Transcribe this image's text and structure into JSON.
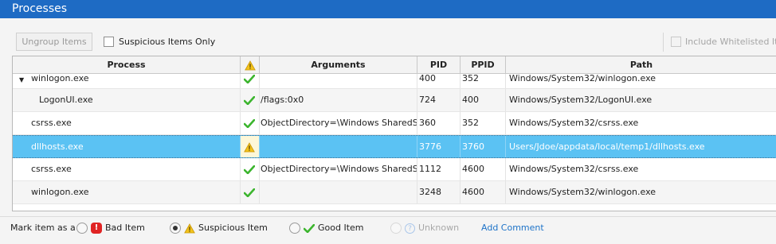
{
  "window": {
    "title": "Processes"
  },
  "toolbar": {
    "ungroup_label": "Ungroup Items",
    "suspicious_only_label": "Suspicious Items Only",
    "include_whitelisted_label": "Include Whitelisted Ite"
  },
  "table": {
    "headers": {
      "process": "Process",
      "arguments": "Arguments",
      "pid": "PID",
      "ppid": "PPID",
      "path": "Path"
    },
    "rows": [
      {
        "process": "winlogon.exe",
        "status": "good",
        "arguments": "",
        "pid": "400",
        "ppid": "352",
        "path": "Windows/System32/winlogon.exe",
        "expanded": true
      },
      {
        "process": "LogonUI.exe",
        "status": "good",
        "arguments": "/flags:0x0",
        "pid": "724",
        "ppid": "400",
        "path": "Windows/System32/LogonUI.exe"
      },
      {
        "process": "csrss.exe",
        "status": "good",
        "arguments": "ObjectDirectory=\\Windows SharedS...",
        "pid": "360",
        "ppid": "352",
        "path": "Windows/System32/csrss.exe"
      },
      {
        "process": "dllhosts.exe",
        "status": "suspicious",
        "arguments": "",
        "pid": "3776",
        "ppid": "3760",
        "path": "Users/Jdoe/appdata/local/temp1/dllhosts.exe",
        "selected": true
      },
      {
        "process": "csrss.exe",
        "status": "good",
        "arguments": "ObjectDirectory=\\Windows SharedS...",
        "pid": "1112",
        "ppid": "4600",
        "path": "Windows/System32/csrss.exe"
      },
      {
        "process": "winlogon.exe",
        "status": "good",
        "arguments": "",
        "pid": "3248",
        "ppid": "4600",
        "path": "Windows/System32/winlogon.exe"
      }
    ]
  },
  "statusbar": {
    "mark_as_label": "Mark item as a",
    "bad_label": "Bad Item",
    "bad_badge": "!",
    "suspicious_label": "Suspicious Item",
    "good_label": "Good Item",
    "unknown_label": "Unknown",
    "unknown_badge": "?",
    "selected": "suspicious",
    "add_comment_label": "Add Comment"
  },
  "colors": {
    "titlebar": "#1e6bc4",
    "selected_row": "#5bc2f3",
    "good": "#3cb52e",
    "warning": "#f2c31b",
    "bad": "#e02323",
    "link": "#1e73c8"
  },
  "icons": {
    "good": "check-icon",
    "suspicious": "warning-icon",
    "bad": "bad-icon",
    "unknown": "question-icon"
  }
}
